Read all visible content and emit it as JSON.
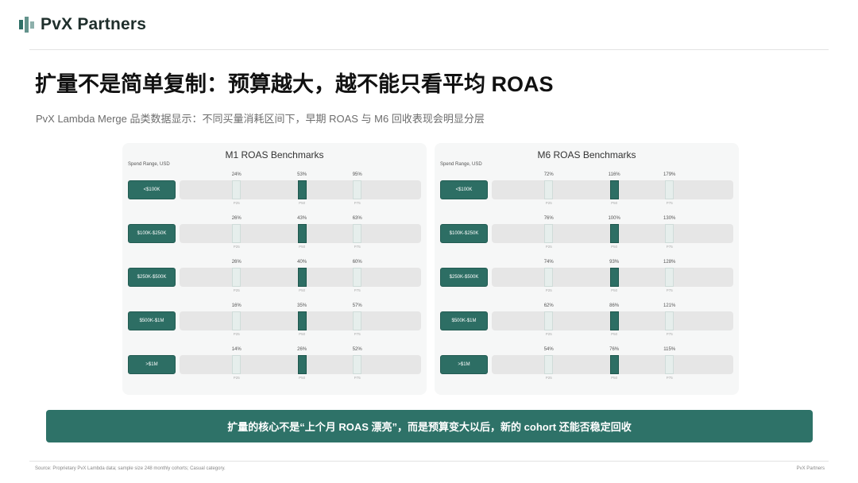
{
  "brand": {
    "name": "PvX Partners",
    "icon": "pvx-logo-icon",
    "color": "#2f6f66"
  },
  "title": "扩量不是简单复制：预算越大，越不能只看平均 ROAS",
  "subtitle": "PvX Lambda Merge 品类数据显示：不同买量消耗区间下，早期 ROAS 与 M6 回收表现会明显分层",
  "percentile_labels": [
    "P25",
    "P50",
    "P75"
  ],
  "chart_data": [
    {
      "type": "table",
      "title": "M1 ROAS Benchmarks",
      "row_header": "Spend Range, USD",
      "categories": [
        "<$100K",
        "$100K-$250K",
        "$250K-$500K",
        "$500K-$1M",
        ">$1M"
      ],
      "series": [
        {
          "name": "P25",
          "values": [
            "24%",
            "26%",
            "26%",
            "16%",
            "14%"
          ]
        },
        {
          "name": "P50",
          "values": [
            "53%",
            "43%",
            "40%",
            "35%",
            "26%"
          ]
        },
        {
          "name": "P75",
          "values": [
            "95%",
            "63%",
            "60%",
            "57%",
            "52%"
          ]
        }
      ]
    },
    {
      "type": "table",
      "title": "M6 ROAS Benchmarks",
      "row_header": "Spend Range, USD",
      "categories": [
        "<$100K",
        "$100K-$250K",
        "$250K-$500K",
        "$500K-$1M",
        ">$1M"
      ],
      "series": [
        {
          "name": "P25",
          "values": [
            "72%",
            "76%",
            "74%",
            "62%",
            "54%"
          ]
        },
        {
          "name": "P50",
          "values": [
            "116%",
            "100%",
            "93%",
            "86%",
            "76%"
          ]
        },
        {
          "name": "P75",
          "values": [
            "179%",
            "130%",
            "128%",
            "121%",
            "115%"
          ]
        }
      ]
    }
  ],
  "banner": "扩量的核心不是“上个月 ROAS 漂亮”，而是预算变大以后，新的 cohort 还能否稳定回收",
  "footer": {
    "source": "Source: Proprietary PvX Lambda data; sample size 248 monthly cohorts; Casual category.",
    "brand": "PvX Partners"
  },
  "colors": {
    "accent": "#2d6e64",
    "panel_bg": "#f6f7f7",
    "track": "#e6e6e6"
  }
}
